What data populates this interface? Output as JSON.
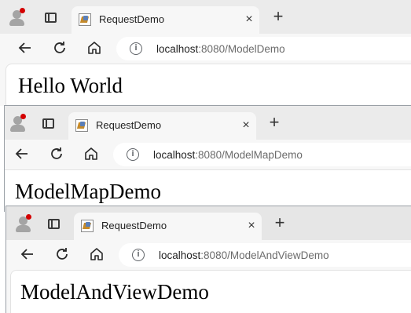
{
  "windows": [
    {
      "tab_title": "RequestDemo",
      "url_host": "localhost",
      "url_path": ":8080/ModelDemo",
      "heading": "Hello World"
    },
    {
      "tab_title": "RequestDemo",
      "url_host": "localhost",
      "url_path": ":8080/ModelMapDemo",
      "heading": "ModelMapDemo"
    },
    {
      "tab_title": "RequestDemo",
      "url_host": "localhost",
      "url_path": ":8080/ModelAndViewDemo",
      "heading": "ModelAndViewDemo"
    }
  ],
  "icons": {
    "close": "×",
    "new_tab": "+",
    "info": "i"
  },
  "colors": {
    "profile_badge": "#d40000",
    "tab_strip": "#ebebeb",
    "page_bg": "#ffffff"
  }
}
